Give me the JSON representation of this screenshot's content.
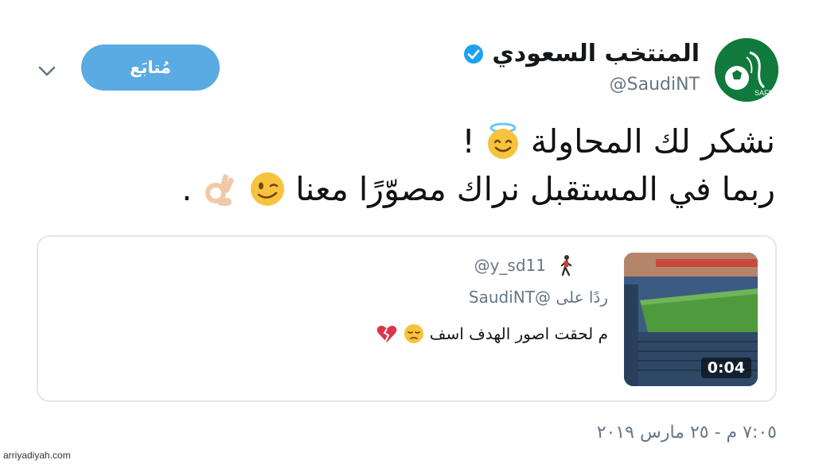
{
  "header": {
    "display_name": "المنتخب السعودي",
    "handle": "@SaudiNT",
    "follow_label": "مُتابَع",
    "avatar_text": "SAFF"
  },
  "tweet": {
    "line1_text": "نشكر لك المحاولة",
    "line1_suffix": "!",
    "line2_text": "ربما في المستقبل نراك مصوّرًا معنا",
    "line2_suffix": "."
  },
  "quote": {
    "handle": "@y_sd11",
    "reply_to": "ردًا على @SaudiNT",
    "text": "م لحقت اصور الهدف اسف",
    "video_duration": "0:04"
  },
  "timestamp": "٧:٠٥ م - ٢٥ مارس ٢٠١٩",
  "watermark": "arriyadiyah.com",
  "colors": {
    "accent": "#5aaae3",
    "verified": "#1da1f2",
    "muted": "#657786",
    "border": "#e1e8ed"
  },
  "icons": [
    "chevron-down-icon",
    "verified-badge-icon",
    "smiling-halo-emoji",
    "winking-emoji",
    "ok-hand-emoji",
    "pensive-emoji",
    "broken-heart-emoji",
    "person-walking-emoji"
  ]
}
